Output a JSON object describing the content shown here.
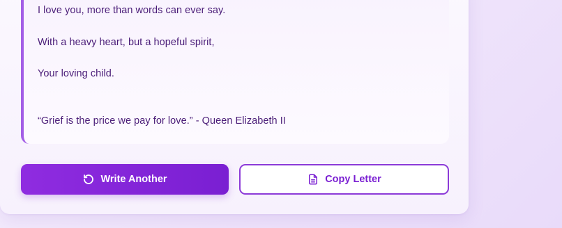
{
  "letter": {
    "lines": [
      "I love you, more than words can ever say.",
      "With a heavy heart, but a hopeful spirit,",
      "Your loving child.",
      "“Grief is the price we pay for love.” - Queen Elizabeth II"
    ]
  },
  "actions": {
    "write_another": {
      "label": "Write Another",
      "icon": "refresh-icon"
    },
    "copy_letter": {
      "label": "Copy Letter",
      "icon": "document-icon"
    }
  },
  "colors": {
    "accent": "#8f2ce0",
    "text": "#4a1d78",
    "letter_border": "#a35ee6"
  }
}
